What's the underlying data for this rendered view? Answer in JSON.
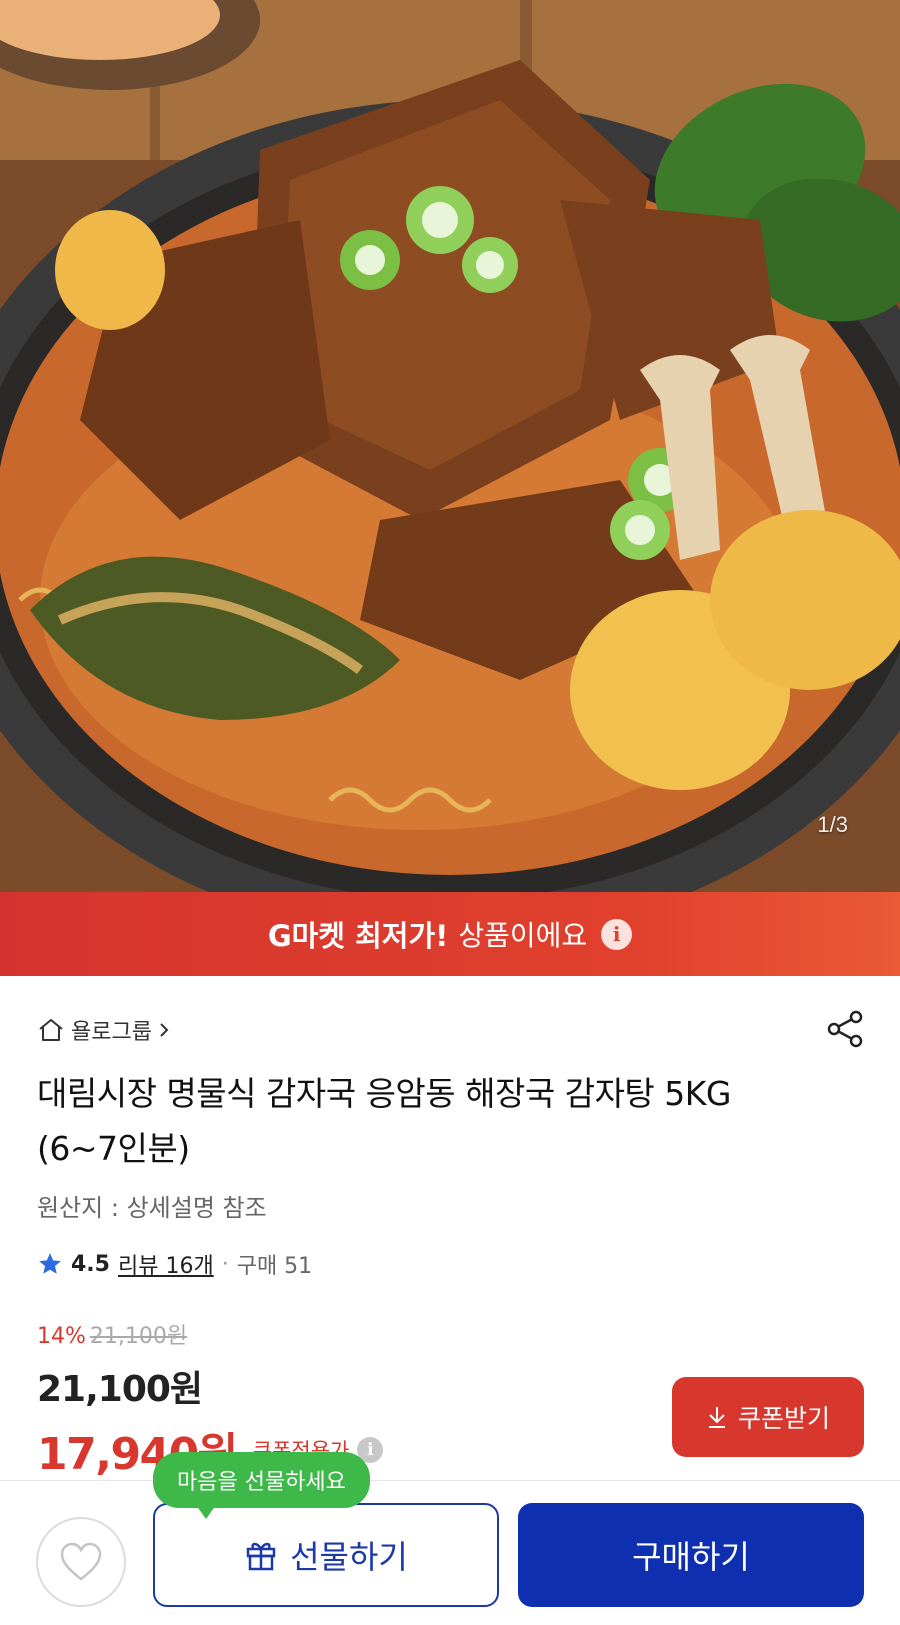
{
  "hero": {
    "image_alt": "감자탕 product photo",
    "counter": "1/3"
  },
  "banner": {
    "bold_text": "G마켓 최저가!",
    "regular_text": "상품이에요",
    "info_icon": "info-icon"
  },
  "product": {
    "seller": "욜로그룹",
    "title": "대림시장 명물식 감자국 응암동 해장국 감자탕 5KG (6~7인분)",
    "origin": "원산지 : 상세설명 참조",
    "rating": "4.5",
    "reviews": "리뷰 16개",
    "separator": "·",
    "purchases": "구매 51"
  },
  "price": {
    "discount_percent": "14%",
    "original_price": "21,100원",
    "sale_price": "21,100원",
    "coupon_price": "17,940원",
    "coupon_label": "쿠폰적용가",
    "coupon_button": "쿠폰받기"
  },
  "bottom_bar": {
    "tooltip": "마음을 선물하세요",
    "gift_button": "선물하기",
    "buy_button": "구매하기"
  },
  "colors": {
    "brand_red": "#d8372e",
    "brand_blue": "#0d2fb0",
    "tooltip_green": "#3fb84a"
  }
}
